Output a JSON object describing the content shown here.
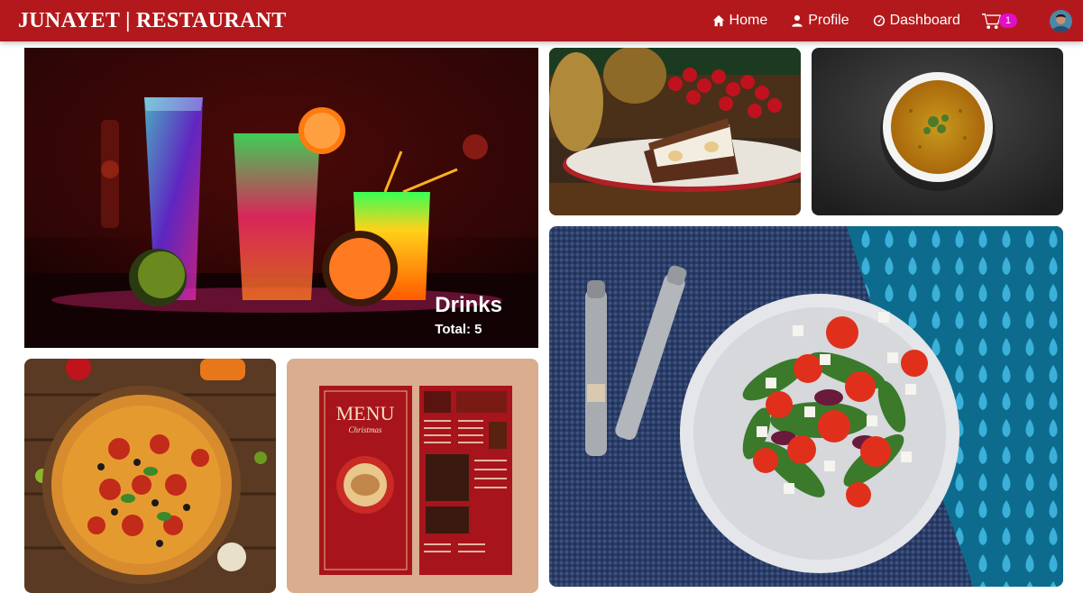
{
  "navbar": {
    "brand": "JUNAYET | RESTAURANT",
    "links": [
      {
        "label": "Home",
        "icon": "home-icon"
      },
      {
        "label": "Profile",
        "icon": "user-icon"
      },
      {
        "label": "Dashboard",
        "icon": "dashboard-icon"
      }
    ],
    "cart_count": "1",
    "colors": {
      "bar": "#b3191c",
      "badge": "#e30ec7"
    }
  },
  "gallery": {
    "featured": {
      "title": "Drinks",
      "total": "Total: 5"
    }
  }
}
